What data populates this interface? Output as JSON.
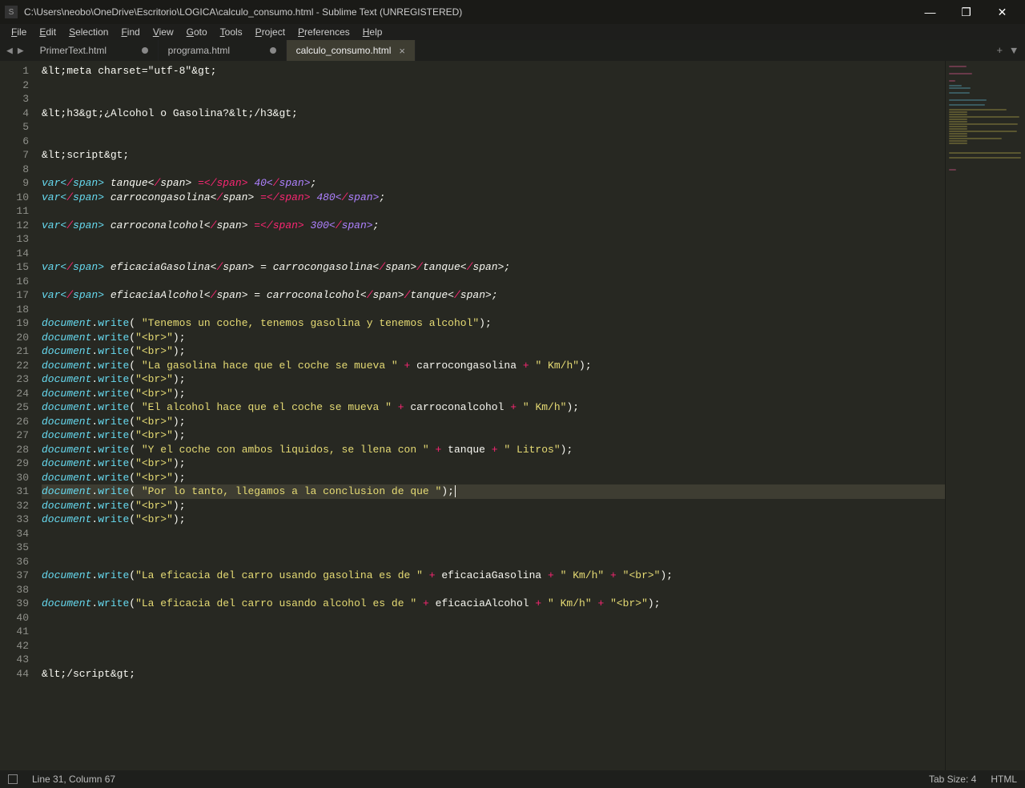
{
  "window": {
    "title": "C:\\Users\\neobo\\OneDrive\\Escritorio\\LOGICA\\calculo_consumo.html - Sublime Text (UNREGISTERED)"
  },
  "menu": {
    "items": [
      "File",
      "Edit",
      "Selection",
      "Find",
      "View",
      "Goto",
      "Tools",
      "Project",
      "Preferences",
      "Help"
    ]
  },
  "tabs": [
    {
      "label": "PrimerText.html",
      "dirty": true,
      "active": false
    },
    {
      "label": "programa.html",
      "dirty": true,
      "active": false
    },
    {
      "label": "calculo_consumo.html",
      "dirty": false,
      "active": true
    }
  ],
  "status": {
    "position": "Line 31, Column 67",
    "tab_size": "Tab Size: 4",
    "syntax": "HTML"
  },
  "cursor": {
    "line": 31,
    "column": 67
  },
  "code_lines": [
    "<meta charset=\"utf-8\">",
    "",
    "",
    "<h3>¿Alcohol o Gasolina?</h3>",
    "",
    "",
    "<script>",
    "",
    "var tanque = 40;",
    "var carrocongasolina = 480;",
    "",
    "var carroconalcohol = 300;",
    "",
    "",
    "var eficaciaGasolina = carrocongasolina/tanque;",
    "",
    "var eficaciaAlcohol = carroconalcohol/tanque;",
    "",
    "document.write( \"Tenemos un coche, tenemos gasolina y tenemos alcohol\");",
    "document.write(\"<br>\");",
    "document.write(\"<br>\");",
    "document.write( \"La gasolina hace que el coche se mueva \" + carrocongasolina + \" Km/h\");",
    "document.write(\"<br>\");",
    "document.write(\"<br>\");",
    "document.write( \"El alcohol hace que el coche se mueva \" + carroconalcohol + \" Km/h\");",
    "document.write(\"<br>\");",
    "document.write(\"<br>\");",
    "document.write( \"Y el coche con ambos liquidos, se llena con \" + tanque + \" Litros\");",
    "document.write(\"<br>\");",
    "document.write(\"<br>\");",
    "document.write( \"Por lo tanto, llegamos a la conclusion de que \");",
    "document.write(\"<br>\");",
    "document.write(\"<br>\");",
    "",
    "",
    "",
    "document.write(\"La eficacia del carro usando gasolina es de \" + eficaciaGasolina + \" Km/h\"+ \"<br>\");",
    "",
    "document.write(\"La eficacia del carro usando alcohol es de \" + eficaciaAlcohol + \" Km/h\"+ \"<br>\");",
    "",
    "",
    "",
    "",
    "</script>"
  ]
}
